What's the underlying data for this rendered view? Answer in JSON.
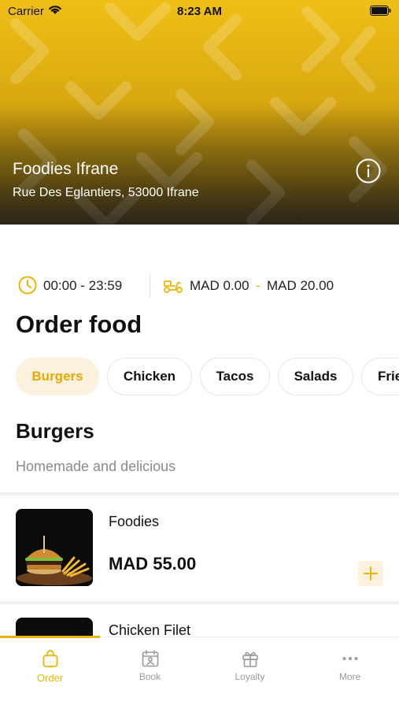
{
  "status_bar": {
    "carrier": "Carrier",
    "time": "8:23 AM"
  },
  "restaurant": {
    "name": "Foodies Ifrane",
    "address": "Rue Des Eglantiers, 53000 Ifrane"
  },
  "info": {
    "hours": "00:00 - 23:59",
    "fee_min": "MAD 0.00",
    "fee_separator": "-",
    "fee_max": "MAD 20.00"
  },
  "page_title": "Order food",
  "categories": [
    "Burgers",
    "Chicken",
    "Tacos",
    "Salads",
    "Fries"
  ],
  "active_category": "Burgers",
  "section": {
    "title": "Burgers",
    "subtitle": "Homemade and delicious"
  },
  "items": [
    {
      "name": "Foodies",
      "price": "MAD 55.00"
    },
    {
      "name": "Chicken Filet"
    }
  ],
  "tabs": [
    {
      "label": "Order",
      "icon": "bag-icon"
    },
    {
      "label": "Book",
      "icon": "calendar-person-icon"
    },
    {
      "label": "Loyalty",
      "icon": "gift-icon"
    },
    {
      "label": "More",
      "icon": "more-dots-icon"
    }
  ],
  "active_tab": "Order",
  "colors": {
    "accent": "#f0b400",
    "accent_light": "#fbf1dd",
    "hero_yellow": "#f0bf16"
  }
}
